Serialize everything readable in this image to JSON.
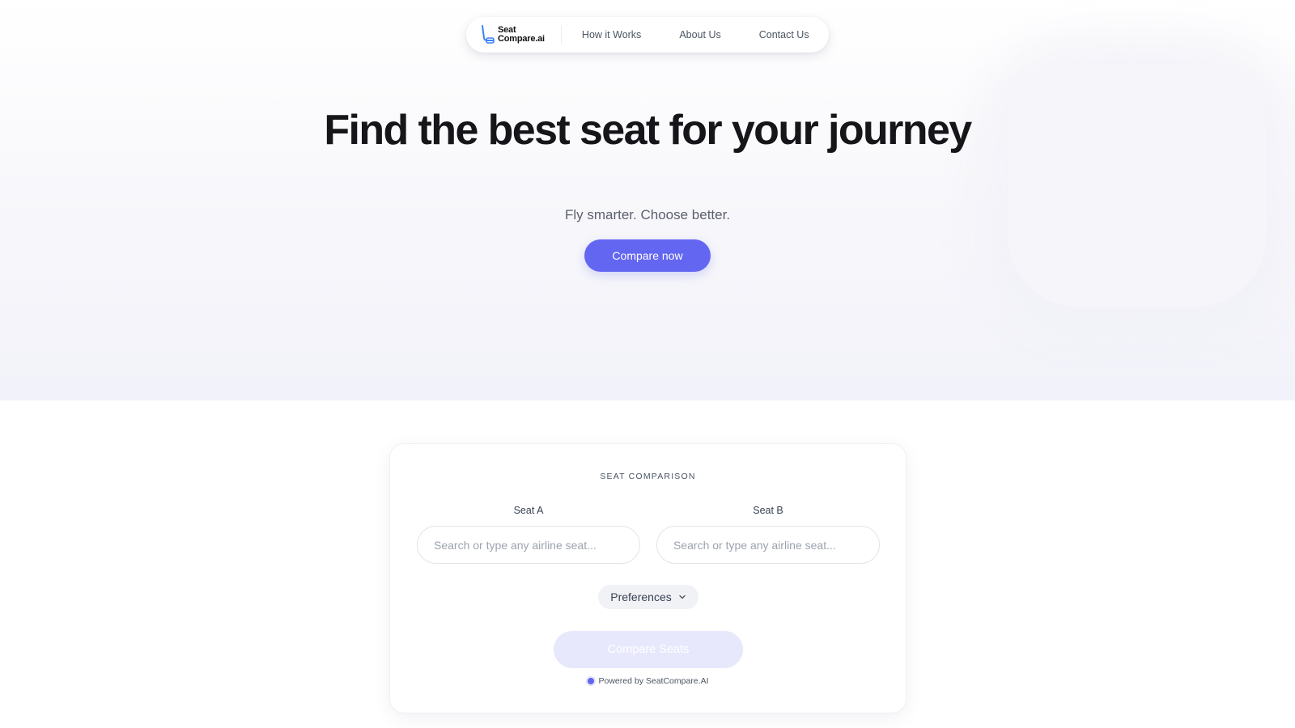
{
  "nav": {
    "logo_line1": "Seat",
    "logo_line2": "Compare.ai",
    "links": [
      "How it Works",
      "About Us",
      "Contact Us"
    ]
  },
  "hero": {
    "title": "Find the best seat for your journey",
    "subtitle": "Fly smarter. Choose better.",
    "cta_label": "Compare now"
  },
  "comparison": {
    "eyebrow": "SEAT COMPARISON",
    "seat_a": {
      "label": "Seat A",
      "placeholder": "Search or type any airline seat...",
      "value": ""
    },
    "seat_b": {
      "label": "Seat B",
      "placeholder": "Search or type any airline seat...",
      "value": ""
    },
    "preferences_label": "Preferences",
    "compare_label": "Compare Seats",
    "powered_by": "Powered by SeatCompare.AI"
  },
  "colors": {
    "accent": "#6366f1",
    "logo_blue": "#3b82f6",
    "disabled_button": "#e7e8fb"
  },
  "icons": {
    "logo": "seat-icon",
    "preferences": "chevron-down-icon",
    "powered": "status-dot-icon"
  }
}
